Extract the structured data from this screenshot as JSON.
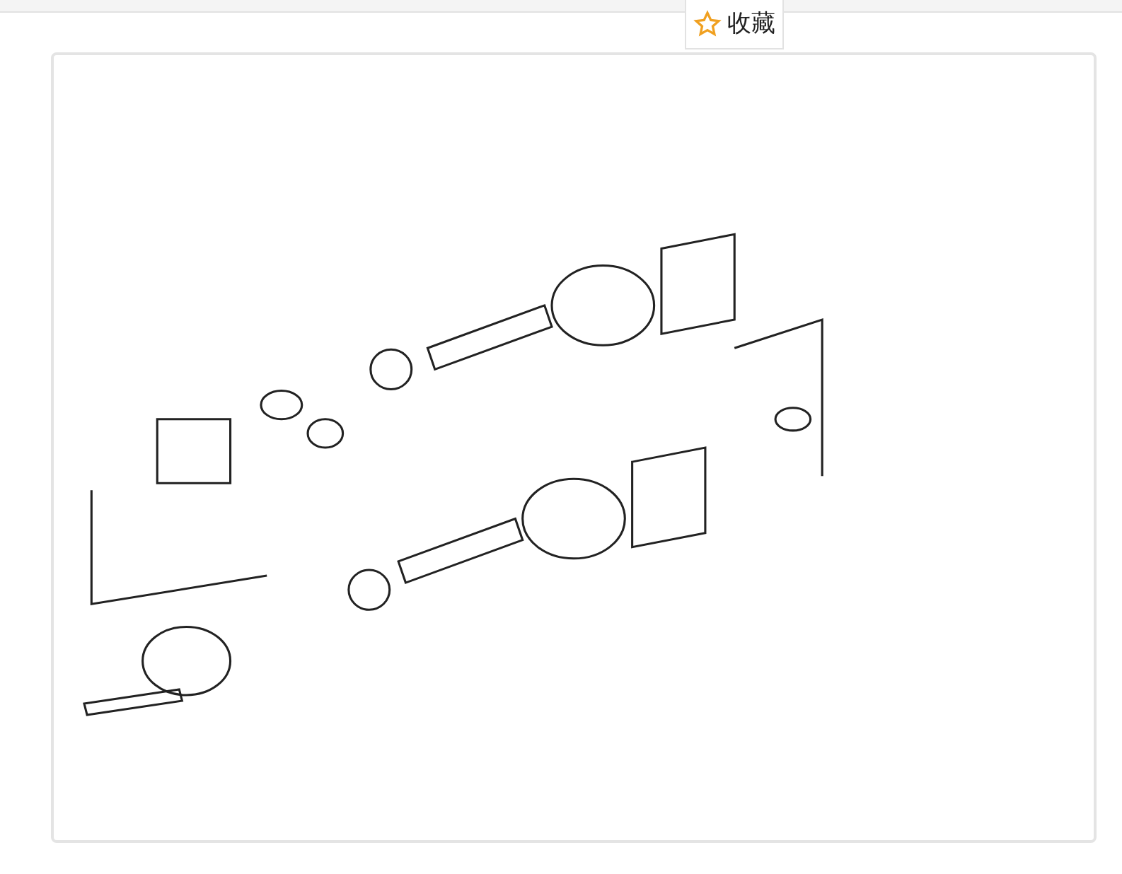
{
  "favorite_button": {
    "label": "收藏"
  }
}
